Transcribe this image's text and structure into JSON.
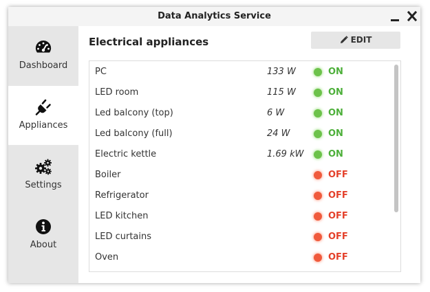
{
  "window": {
    "title": "Data Analytics Service"
  },
  "sidebar": {
    "items": [
      {
        "label": "Dashboard",
        "icon": "speedometer-icon",
        "active": false
      },
      {
        "label": "Appliances",
        "icon": "plug-icon",
        "active": true
      },
      {
        "label": "Settings",
        "icon": "gears-icon",
        "active": false
      },
      {
        "label": "About",
        "icon": "info-icon",
        "active": false
      }
    ]
  },
  "main": {
    "title": "Electrical appliances",
    "edit_label": "EDIT",
    "appliances": [
      {
        "name": "PC",
        "power": "133 W",
        "status": "ON"
      },
      {
        "name": "LED room",
        "power": "115 W",
        "status": "ON"
      },
      {
        "name": "Led balcony (top)",
        "power": "6 W",
        "status": "ON"
      },
      {
        "name": "Led balcony (full)",
        "power": "24 W",
        "status": "ON"
      },
      {
        "name": "Electric kettle",
        "power": "1.69 kW",
        "status": "ON"
      },
      {
        "name": "Boiler",
        "power": "",
        "status": "OFF"
      },
      {
        "name": "Refrigerator",
        "power": "",
        "status": "OFF"
      },
      {
        "name": "LED kitchen",
        "power": "",
        "status": "OFF"
      },
      {
        "name": "LED curtains",
        "power": "",
        "status": "OFF"
      },
      {
        "name": "Oven",
        "power": "",
        "status": "OFF"
      }
    ]
  },
  "colors": {
    "on": "#4caf39",
    "off": "#e4402a",
    "sidebar_bg": "#e6e6e6",
    "active_bg": "#ffffff"
  }
}
